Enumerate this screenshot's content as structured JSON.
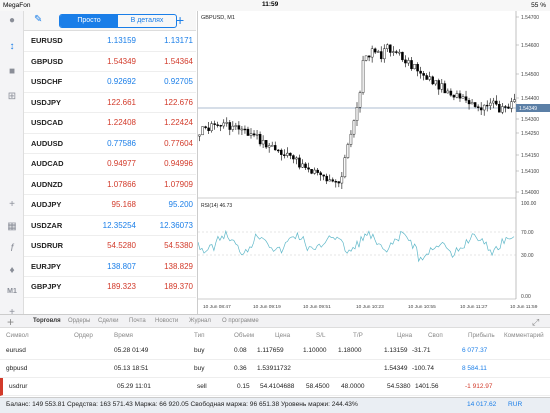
{
  "status": {
    "carrier": "MegaFon",
    "time": "11:59",
    "battery": "55 %"
  },
  "toolbar": {
    "tab_simple": "Просто",
    "tab_detail": "В деталях"
  },
  "quotes": [
    {
      "symbol": "EURUSD",
      "bid": "1.13159",
      "ask": "1.13171",
      "bid_dir": "up",
      "ask_dir": "up"
    },
    {
      "symbol": "GBPUSD",
      "bid": "1.54349",
      "ask": "1.54364",
      "bid_dir": "dn",
      "ask_dir": "dn"
    },
    {
      "symbol": "USDCHF",
      "bid": "0.92692",
      "ask": "0.92705",
      "bid_dir": "up",
      "ask_dir": "up"
    },
    {
      "symbol": "USDJPY",
      "bid": "122.661",
      "ask": "122.676",
      "bid_dir": "dn",
      "ask_dir": "dn"
    },
    {
      "symbol": "USDCAD",
      "bid": "1.22408",
      "ask": "1.22424",
      "bid_dir": "dn",
      "ask_dir": "dn"
    },
    {
      "symbol": "AUDUSD",
      "bid": "0.77586",
      "ask": "0.77604",
      "bid_dir": "up",
      "ask_dir": "dn"
    },
    {
      "symbol": "AUDCAD",
      "bid": "0.94977",
      "ask": "0.94996",
      "bid_dir": "dn",
      "ask_dir": "dn"
    },
    {
      "symbol": "AUDNZD",
      "bid": "1.07866",
      "ask": "1.07909",
      "bid_dir": "dn",
      "ask_dir": "dn"
    },
    {
      "symbol": "AUDJPY",
      "bid": "95.168",
      "ask": "95.200",
      "bid_dir": "dn",
      "ask_dir": "up"
    },
    {
      "symbol": "USDZAR",
      "bid": "12.35254",
      "ask": "12.36073",
      "bid_dir": "up",
      "ask_dir": "up"
    },
    {
      "symbol": "USDRUR",
      "bid": "54.5280",
      "ask": "54.5380",
      "bid_dir": "dn",
      "ask_dir": "dn"
    },
    {
      "symbol": "EURJPY",
      "bid": "138.807",
      "ask": "138.829",
      "bid_dir": "up",
      "ask_dir": "dn"
    },
    {
      "symbol": "GBPJPY",
      "bid": "189.323",
      "ask": "189.370",
      "bid_dir": "dn",
      "ask_dir": "dn"
    }
  ],
  "chart": {
    "title": "GBPUSD, M1",
    "price_ticks": [
      "1.54700",
      "1.54600",
      "1.54500",
      "1.54400",
      "1.54300",
      "1.54250",
      "1.54150",
      "1.54100",
      "1.54000"
    ],
    "current_price": "1.54349",
    "rsi_label": "RSI(14) 46.73",
    "rsi_ticks": [
      "100.00",
      "70.00",
      "30.00",
      "0.00"
    ],
    "time_ticks": [
      "10 Jun 08:47",
      "10 Jun 09:19",
      "10 Jun 09:51",
      "10 Jun 10:23",
      "10 Jun 10:55",
      "10 Jun 11:27",
      "10 Jun 11:59"
    ]
  },
  "chart_data": {
    "type": "candlestick",
    "symbol": "GBPUSD",
    "timeframe": "M1",
    "indicator": "RSI(14)",
    "rsi_value": 46.73
  },
  "tabs": [
    "Торговля",
    "Ордеры",
    "Сделки",
    "Почта",
    "Новости",
    "Журнал",
    "О программе"
  ],
  "columns": [
    "Символ",
    "Ордер",
    "Время",
    "Тип",
    "Объем",
    "Цена",
    "S/L",
    "T/P",
    "Цена",
    "Своп",
    "Прибыль",
    "Комментарий"
  ],
  "trades": [
    {
      "symbol": "eurusd",
      "time": "05.28 01:49",
      "type": "buy",
      "volume": "0.08",
      "price": "1.117659",
      "sl": "1.10000",
      "tp": "1.18000",
      "cur": "1.13159",
      "swap": "-31.71",
      "profit": "6 077.37",
      "pdir": "up"
    },
    {
      "symbol": "gbpusd",
      "time": "05.13 18:51",
      "type": "buy",
      "volume": "0.36",
      "price": "1.53911732",
      "sl": "",
      "tp": "",
      "cur": "1.54349",
      "swap": "-100.74",
      "profit": "8 584.11",
      "pdir": "up"
    },
    {
      "symbol": "usdrur",
      "time": "05.29 11:01",
      "type": "sell",
      "volume": "0.15",
      "price": "54.4104688",
      "sl": "58.4500",
      "tp": "48.0000",
      "cur": "54.5380",
      "swap": "1401.56",
      "profit": "-1 912.97",
      "pdir": "dn"
    }
  ],
  "footer": {
    "text": "Баланс: 149 553.81 Средства: 163 571.43 Маржа: 66 920.05 Свободная маржа: 96 651.38 Уровень маржи: 244.43%",
    "total": "14 017.62",
    "currency": "RUR"
  }
}
